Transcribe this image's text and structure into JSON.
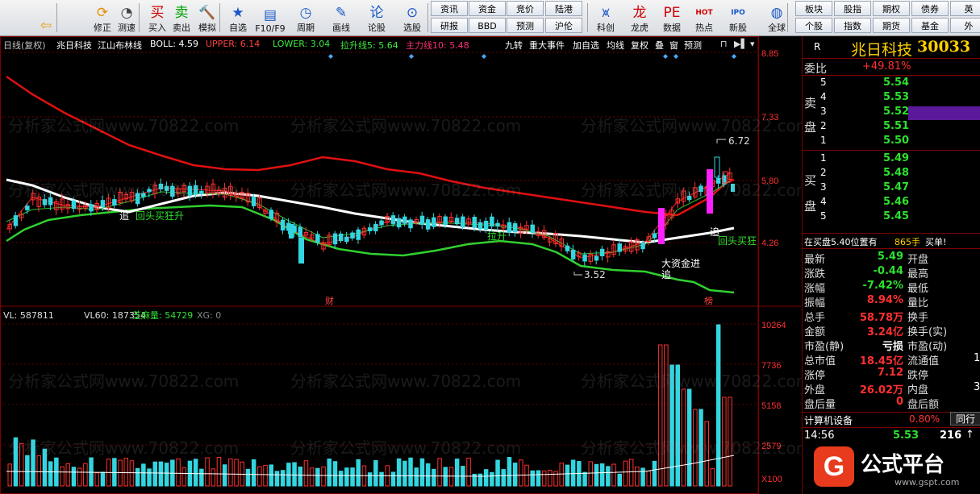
{
  "toolbar": {
    "big_buttons": [
      {
        "label": "",
        "icon": "back-arrow-icon",
        "glyph": "⇦",
        "color": "#e8a000"
      },
      {
        "label": "修正",
        "icon": "refresh-icon",
        "glyph": "⟳",
        "color": "#e39000"
      },
      {
        "label": "测速",
        "icon": "stopwatch-icon",
        "glyph": "◔",
        "color": "#444"
      },
      {
        "label": "买入",
        "icon": "buy-icon",
        "glyph": "买",
        "color": "#d00000"
      },
      {
        "label": "卖出",
        "icon": "sell-icon",
        "glyph": "卖",
        "color": "#00a000"
      },
      {
        "label": "模拟",
        "icon": "hammer-icon",
        "glyph": "🔨",
        "color": "#8a4a00"
      },
      {
        "label": "自选",
        "icon": "star-folder-icon",
        "glyph": "★",
        "color": "#1a57c8"
      },
      {
        "label": "F10/F9",
        "icon": "f10-icon",
        "glyph": "▤",
        "color": "#1a57c8"
      },
      {
        "label": "周期",
        "icon": "clock-icon",
        "glyph": "◷",
        "color": "#1a57c8"
      },
      {
        "label": "画线",
        "icon": "pencil-icon",
        "glyph": "✎",
        "color": "#1a57c8"
      },
      {
        "label": "论股",
        "icon": "discuss-icon",
        "glyph": "论",
        "color": "#1a57c8"
      },
      {
        "label": "选股",
        "icon": "magnifier-icon",
        "glyph": "⊙",
        "color": "#1a57c8"
      },
      {
        "label": "科创",
        "icon": "chart-icon",
        "glyph": "⩙",
        "color": "#1a57c8"
      },
      {
        "label": "龙虎",
        "icon": "dragon-icon",
        "glyph": "龙",
        "color": "#d00000"
      },
      {
        "label": "数据",
        "icon": "pe-icon",
        "glyph": "PE",
        "color": "#d00000"
      },
      {
        "label": "热点",
        "icon": "hot-icon",
        "glyph": "HOT",
        "color": "#d00000"
      },
      {
        "label": "新股",
        "icon": "ipo-icon",
        "glyph": "IPO",
        "color": "#1a57c8"
      },
      {
        "label": "全球",
        "icon": "globe-icon",
        "glyph": "◍",
        "color": "#1a57c8"
      }
    ],
    "small_row1": [
      "资讯",
      "资金",
      "竞价",
      "陆港"
    ],
    "small_row2": [
      "研报",
      "BBD",
      "预测",
      "沪伦"
    ],
    "right_row1": [
      "板块",
      "股指",
      "期权",
      "债券",
      "英"
    ],
    "right_row2": [
      "个股",
      "指数",
      "期货",
      "基金",
      "外"
    ]
  },
  "info": {
    "period": "日线(复权)",
    "stock": "兆日科技",
    "indicator": "江山布林线",
    "boll": "BOLL: 4.59",
    "upper": "UPPER: 6.14",
    "lower": "LOWER: 3.04",
    "lasheng": "拉升线5: 5.64",
    "zhuli": "主力线10: 5.48",
    "tabs": [
      "九转",
      "重大事件",
      "加自选",
      "均线",
      "复权",
      "叠",
      "窗",
      "预测"
    ]
  },
  "axis": {
    "price": [
      "8.85",
      "7.33",
      "5.80",
      "4.26"
    ],
    "volume": [
      "10264",
      "7736",
      "5158",
      "2579",
      "X100"
    ]
  },
  "vol_info": {
    "vl": "VL: 587811",
    "vl60": "VL60: 187354",
    "zhima": "芝麻量: 54729",
    "xg": "XG: 0"
  },
  "annotations": {
    "high": "6.72",
    "low": "3.52",
    "zhui1": "追",
    "huitou1": "回头买狂升",
    "lasheng_text": "拉升",
    "zhui2": "追",
    "huitou2": "回头买狂",
    "bigmoney": "大资金进",
    "zhui3": "追",
    "cai": "财",
    "bang": "榜"
  },
  "watermark": "分析家公式网www.70822.com",
  "right": {
    "r": "R",
    "name": "兆日科技",
    "code": "30033",
    "weibi_label": "委比",
    "weibi": "+49.81%",
    "sell_label": [
      "卖",
      "盘"
    ],
    "sell": [
      {
        "n": "5",
        "p": "5.54"
      },
      {
        "n": "4",
        "p": "5.53"
      },
      {
        "n": "3",
        "p": "5.52"
      },
      {
        "n": "2",
        "p": "5.51"
      },
      {
        "n": "1",
        "p": "5.50"
      }
    ],
    "buy_label": [
      "买",
      "盘"
    ],
    "buy": [
      {
        "n": "1",
        "p": "5.49"
      },
      {
        "n": "2",
        "p": "5.48"
      },
      {
        "n": "3",
        "p": "5.47"
      },
      {
        "n": "4",
        "p": "5.46"
      },
      {
        "n": "5",
        "p": "5.45"
      }
    ],
    "queue": "在买盘5.40位置有",
    "queue_vol": "865手",
    "queue_tag": "买单!",
    "stats": [
      {
        "l": "最新",
        "v": "5.49",
        "l2": "开盘",
        "v2": ""
      },
      {
        "l": "涨跌",
        "v": "-0.44",
        "l2": "最高",
        "v2": ""
      },
      {
        "l": "涨幅",
        "v": "-7.42%",
        "l2": "最低",
        "v2": ""
      },
      {
        "l": "振幅",
        "v": "8.94%",
        "l2": "量比",
        "v2": ""
      },
      {
        "l": "总手",
        "v": "58.78万",
        "l2": "换手",
        "v2": ""
      },
      {
        "l": "金额",
        "v": "3.24亿",
        "l2": "换手(实)",
        "v2": ""
      },
      {
        "l": "市盈(静)",
        "v": "亏损",
        "l2": "市盈(动)",
        "v2": ""
      },
      {
        "l": "总市值",
        "v": "18.45亿",
        "l2": "流通值",
        "v2": "1"
      },
      {
        "l": "涨停",
        "v": "7.12",
        "l2": "跌停",
        "v2": ""
      },
      {
        "l": "外盘",
        "v": "26.02万",
        "l2": "内盘",
        "v2": "3"
      },
      {
        "l": "盘后量",
        "v": "0",
        "l2": "盘后额",
        "v2": ""
      }
    ],
    "industry": "计算机设备",
    "industry_pct": "0.80%",
    "tongxing": "同行",
    "tick_time": "14:56",
    "tick_price": "5.53",
    "tick_vol": "216"
  },
  "logo": {
    "text": "公式平台",
    "url": "www.gspt.com"
  }
}
